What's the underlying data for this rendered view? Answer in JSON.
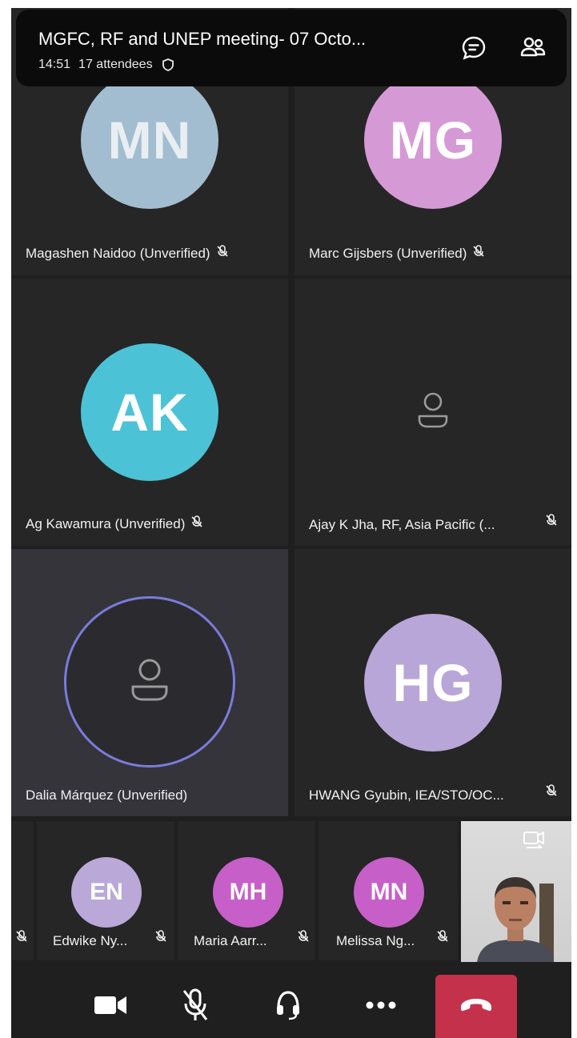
{
  "header": {
    "title": "MGFC, RF and UNEP meeting- 07 Octo...",
    "time": "14:51",
    "attendees": "17 attendees"
  },
  "tiles": [
    {
      "name": "Magashen Naidoo (Unverified)",
      "initials": "MN",
      "color": "#a2bdd0"
    },
    {
      "name": "Marc Gijsbers (Unverified)",
      "initials": "MG",
      "color": "#d59ad6"
    },
    {
      "name": "Ag Kawamura (Unverified)",
      "initials": "AK",
      "color": "#4cc2d6"
    },
    {
      "name": "Ajay K Jha, RF, Asia Pacific (...",
      "initials": ""
    },
    {
      "name": "Dalia Márquez  (Unverified)",
      "initials": ""
    },
    {
      "name": "HWANG Gyubin, IEA/STO/OC...",
      "initials": "HG",
      "color": "#b8a6d8"
    }
  ],
  "strip": [
    {
      "name": "Edwike Ny...",
      "initials": "EN",
      "color": "#b9a8d8"
    },
    {
      "name": "Maria Aarr...",
      "initials": "MH",
      "color": "#c65fc8"
    },
    {
      "name": "Melissa Ng...",
      "initials": "MN",
      "color": "#c65fc8"
    }
  ],
  "icons": {
    "chat": "chat-icon",
    "people": "people-icon",
    "camera": "video-camera-icon",
    "mic": "microphone-off-icon",
    "audio": "headset-icon",
    "more": "more-icon",
    "hangup": "hang-up-icon"
  },
  "colors": {
    "hangup": "#c4314b",
    "speaking_ring": "#7b7bdc"
  }
}
